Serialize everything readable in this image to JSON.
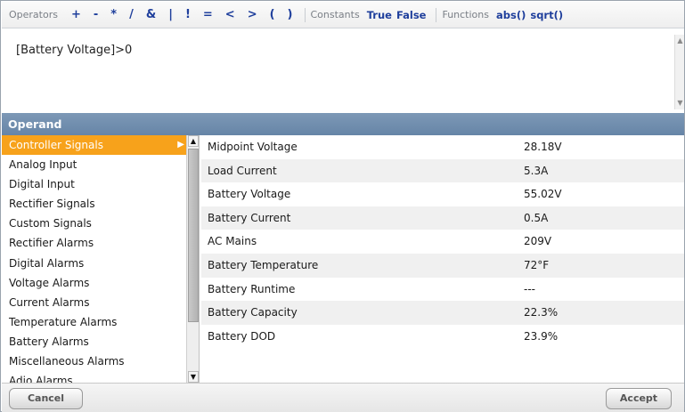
{
  "toolbar": {
    "operators_label": "Operators",
    "operators": [
      "+",
      "-",
      "*",
      "/",
      "&",
      "|",
      "!",
      "=",
      "<",
      ">",
      "(",
      ")"
    ],
    "constants_label": "Constants",
    "constants": [
      "True",
      "False"
    ],
    "functions_label": "Functions",
    "functions": [
      "abs()",
      "sqrt()"
    ]
  },
  "expression": {
    "text": "[Battery Voltage]>0"
  },
  "operand": {
    "header": "Operand",
    "categories": [
      "Controller Signals",
      "Analog Input",
      "Digital Input",
      "Rectifier Signals",
      "Custom Signals",
      "Rectifier Alarms",
      "Digital Alarms",
      "Voltage Alarms",
      "Current Alarms",
      "Temperature Alarms",
      "Battery Alarms",
      "Miscellaneous Alarms",
      "Adio Alarms"
    ],
    "selected_category": "Controller Signals",
    "signals": [
      {
        "name": "Midpoint Voltage",
        "value": "28.18V"
      },
      {
        "name": "Load Current",
        "value": "5.3A"
      },
      {
        "name": "Battery Voltage",
        "value": "55.02V"
      },
      {
        "name": "Battery Current",
        "value": "0.5A"
      },
      {
        "name": "AC Mains",
        "value": "209V"
      },
      {
        "name": "Battery Temperature",
        "value": "72°F"
      },
      {
        "name": "Battery Runtime",
        "value": "---"
      },
      {
        "name": "Battery Capacity",
        "value": "22.3%"
      },
      {
        "name": "Battery DOD",
        "value": "23.9%"
      }
    ]
  },
  "buttons": {
    "cancel": "Cancel",
    "accept": "Accept"
  },
  "colors": {
    "selected": "#f7a21b",
    "header": "#7592b2",
    "link": "#1f3f9c"
  }
}
